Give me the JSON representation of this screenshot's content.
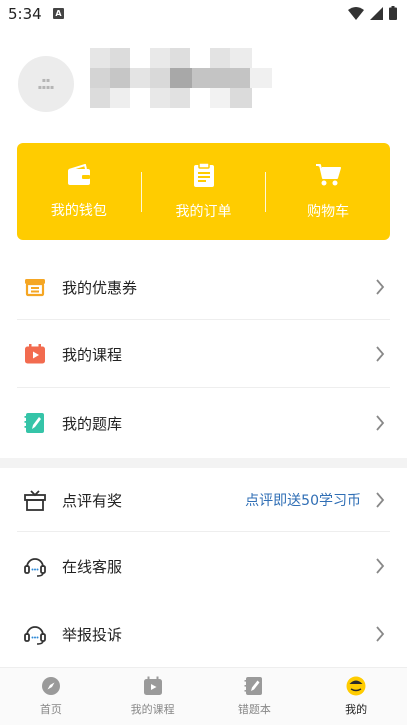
{
  "status_bar": {
    "time": "5:34",
    "notification_letter": "A"
  },
  "wallet": {
    "items": [
      {
        "label": "我的钱包",
        "icon": "wallet-icon"
      },
      {
        "label": "我的订单",
        "icon": "order-clipboard-icon"
      },
      {
        "label": "购物车",
        "icon": "cart-icon"
      }
    ],
    "accent": "#ffcc00"
  },
  "menu_group1": [
    {
      "label": "我的优惠券",
      "icon": "coupon-icon",
      "icon_color": "#f5a623"
    },
    {
      "label": "我的课程",
      "icon": "course-calendar-icon",
      "icon_color": "#f26b4f"
    },
    {
      "label": "我的题库",
      "icon": "question-bank-icon",
      "icon_color": "#35c4a8"
    }
  ],
  "menu_group2": [
    {
      "label": "点评有奖",
      "icon": "gift-icon",
      "extra": "点评即送50学习币"
    },
    {
      "label": "在线客服",
      "icon": "headset-icon"
    },
    {
      "label": "举报投诉",
      "icon": "report-headset-icon"
    }
  ],
  "tabbar": [
    {
      "label": "首页",
      "icon": "compass-icon",
      "active": false
    },
    {
      "label": "我的课程",
      "icon": "course-tab-icon",
      "active": false
    },
    {
      "label": "错题本",
      "icon": "notebook-icon",
      "active": false
    },
    {
      "label": "我的",
      "icon": "profile-face-icon",
      "active": true
    }
  ],
  "link_color": "#2f6eb5"
}
